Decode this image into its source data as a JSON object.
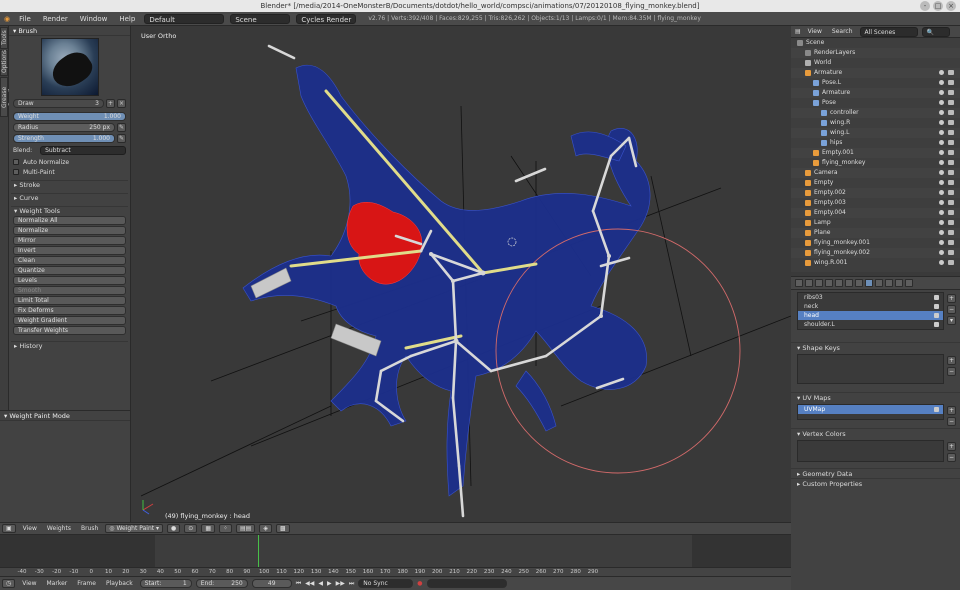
{
  "window": {
    "title": "Blender* [/media/2014-OneMonsterB/Documents/dotdot/hello_world/compsci/animations/07/20120108_flying_monkey.blend]",
    "buttons": [
      "-",
      "□",
      "×"
    ]
  },
  "info_bar": {
    "menus": [
      "File",
      "Render",
      "Window",
      "Help"
    ],
    "layout": "Default",
    "scene": "Scene",
    "engine": "Cycles Render",
    "stats": "v2.76 | Verts:392/408 | Faces:829,255 | Tris:826,262 | Objects:1/13 | Lamps:0/1 | Mem:84.35M | flying_monkey"
  },
  "left_tabs": [
    "Tools",
    "Options",
    "Grease Pencil"
  ],
  "tool_panel": {
    "brush_header": "Brush",
    "brush_name": "Draw",
    "brush_users": "3",
    "weight": {
      "label": "Weight",
      "value": "1.000",
      "fill": 1.0
    },
    "radius": {
      "label": "Radius",
      "value": "250 px",
      "fill": 0.5
    },
    "strength": {
      "label": "Strength",
      "value": "1.000",
      "fill": 1.0
    },
    "blend_label": "Blend:",
    "blend_value": "Subtract",
    "auto_normalize": "Auto Normalize",
    "multi_paint": "Multi-Paint",
    "sections": {
      "stroke": "Stroke",
      "curve": "Curve",
      "weight_tools": "Weight Tools",
      "history": "History"
    },
    "weight_tools": [
      "Normalize All",
      "Normalize",
      "Mirror",
      "Invert",
      "Clean",
      "Quantize",
      "Levels",
      "Smooth",
      "Limit Total",
      "Fix Deforms",
      "Weight Gradient",
      "Transfer Weights"
    ]
  },
  "operator_panel": {
    "title": "Weight Paint Mode"
  },
  "viewport": {
    "view_label": "User Ortho",
    "object_label": "(49) flying_monkey : head"
  },
  "viewport_header": {
    "menus": [
      "View",
      "Weights",
      "Brush"
    ],
    "mode": "Weight Paint"
  },
  "timeline": {
    "ticks": [
      "-40",
      "-30",
      "-20",
      "-10",
      "0",
      "10",
      "20",
      "30",
      "40",
      "50",
      "60",
      "70",
      "80",
      "90",
      "100",
      "110",
      "120",
      "130",
      "140",
      "150",
      "160",
      "170",
      "180",
      "190",
      "200",
      "210",
      "220",
      "230",
      "240",
      "250",
      "260",
      "270",
      "280",
      "290"
    ],
    "menus": [
      "View",
      "Marker",
      "Frame",
      "Playback"
    ],
    "start": "Start:",
    "start_value": "1",
    "end": "End:",
    "end_value": "250",
    "current": "49",
    "sync": "No Sync"
  },
  "outliner": {
    "menus": [
      "View",
      "Search"
    ],
    "filter": "All Scenes",
    "rows": [
      "Scene",
      "RenderLayers",
      "World",
      "Armature",
      "Pose.L",
      "Armature",
      "Pose",
      "controller",
      "wing.R",
      "wing.L",
      "hips",
      "Empty.001",
      "flying_monkey",
      "Camera",
      "Empty",
      "Empty.002",
      "Empty.003",
      "Empty.004",
      "Lamp",
      "Plane",
      "flying_monkey.001",
      "flying_monkey.002",
      "wing.R.001"
    ]
  },
  "properties": {
    "vertex_groups": [
      "ribs03",
      "neck",
      "head",
      "shoulder.L"
    ],
    "selected_group": "head",
    "shape_keys": "Shape Keys",
    "uv_maps": "UV Maps",
    "uv_map_name": "UVMap",
    "vertex_colors": "Vertex Colors",
    "geometry_data": "Geometry Data",
    "custom_properties": "Custom Properties"
  }
}
